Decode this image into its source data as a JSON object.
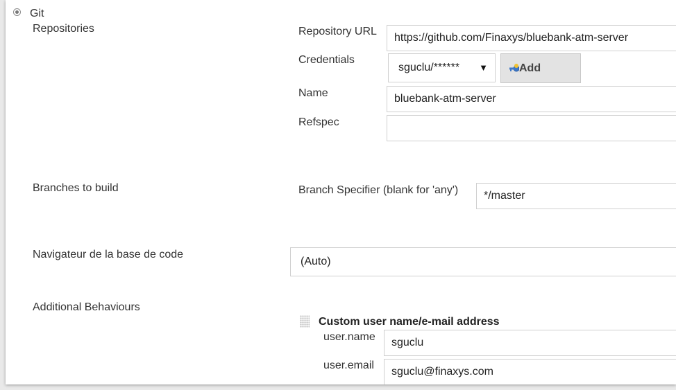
{
  "scm": {
    "option_label": "Git",
    "selected": true
  },
  "repositories": {
    "section_label": "Repositories",
    "url_label": "Repository URL",
    "url_value": "https://github.com/Finaxys/bluebank-atm-server",
    "credentials_label": "Credentials",
    "credentials_value": "sguclu/******",
    "add_button_label": "Add",
    "name_label": "Name",
    "name_value": "bluebank-atm-server",
    "refspec_label": "Refspec",
    "refspec_value": ""
  },
  "branches": {
    "section_label": "Branches to build",
    "specifier_label": "Branch Specifier (blank for 'any')",
    "specifier_value": "*/master"
  },
  "browser": {
    "section_label": "Navigateur de la base de code",
    "value": "(Auto)"
  },
  "behaviours": {
    "section_label": "Additional Behaviours",
    "custom_user_title": "Custom user name/e-mail address",
    "username_label": "user.name",
    "username_value": "sguclu",
    "email_label": "user.email",
    "email_value": "sguclu@finaxys.com"
  },
  "colors": {
    "panel_bg": "#ffffff",
    "outer_bg": "#e9e9e9",
    "field_border": "#cfcfcf",
    "button_bg": "#e3e3e3"
  },
  "icons": {
    "key": "key-icon",
    "drag_handle": "drag-handle-icon",
    "dropdown": "chevron-down-icon"
  }
}
